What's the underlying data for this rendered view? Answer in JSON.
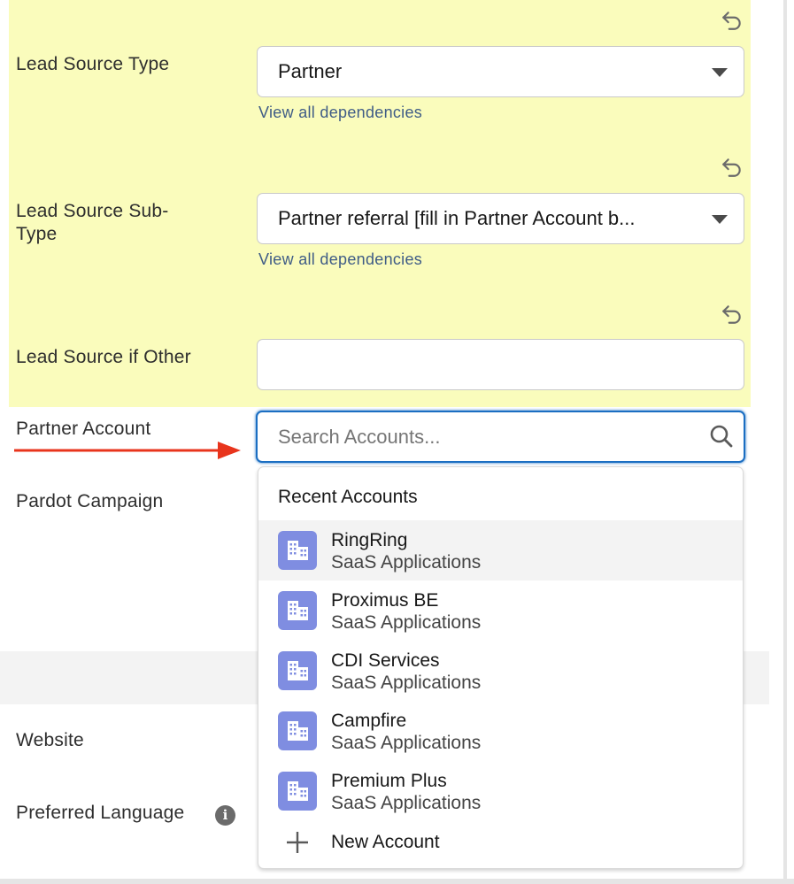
{
  "fields": {
    "lead_source_type": {
      "label": "Lead Source Type",
      "value": "Partner",
      "link": "View all dependencies"
    },
    "lead_source_subtype": {
      "label_line1": "Lead Source Sub-",
      "label_line2": "Type",
      "value": "Partner referral [fill in Partner Account b...",
      "link": "View all dependencies"
    },
    "lead_source_other": {
      "label": "Lead Source if Other",
      "value": ""
    },
    "partner_account": {
      "label": "Partner Account",
      "placeholder": "Search Accounts..."
    },
    "pardot_campaign": {
      "label": "Pardot Campaign"
    },
    "website": {
      "label": "Website"
    },
    "preferred_language": {
      "label": "Preferred Language",
      "info": "i"
    }
  },
  "dropdown": {
    "header": "Recent Accounts",
    "items": [
      {
        "name": "RingRing",
        "sub": "SaaS Applications"
      },
      {
        "name": "Proximus BE",
        "sub": "SaaS Applications"
      },
      {
        "name": "CDI Services",
        "sub": "SaaS Applications"
      },
      {
        "name": "Campfire",
        "sub": "SaaS Applications"
      },
      {
        "name": "Premium Plus",
        "sub": "SaaS Applications"
      }
    ],
    "new_account": "New Account"
  },
  "colors": {
    "highlight": "#fafcbc",
    "focus_border": "#1b6ec2",
    "link": "#3f5c86",
    "account_icon": "#7f8de1",
    "arrow": "#e8341c"
  },
  "icons": {
    "undo": "undo-icon",
    "caret": "chevron-down-icon",
    "search": "search-icon",
    "account": "building-icon",
    "add": "plus-icon",
    "info": "info-icon"
  }
}
